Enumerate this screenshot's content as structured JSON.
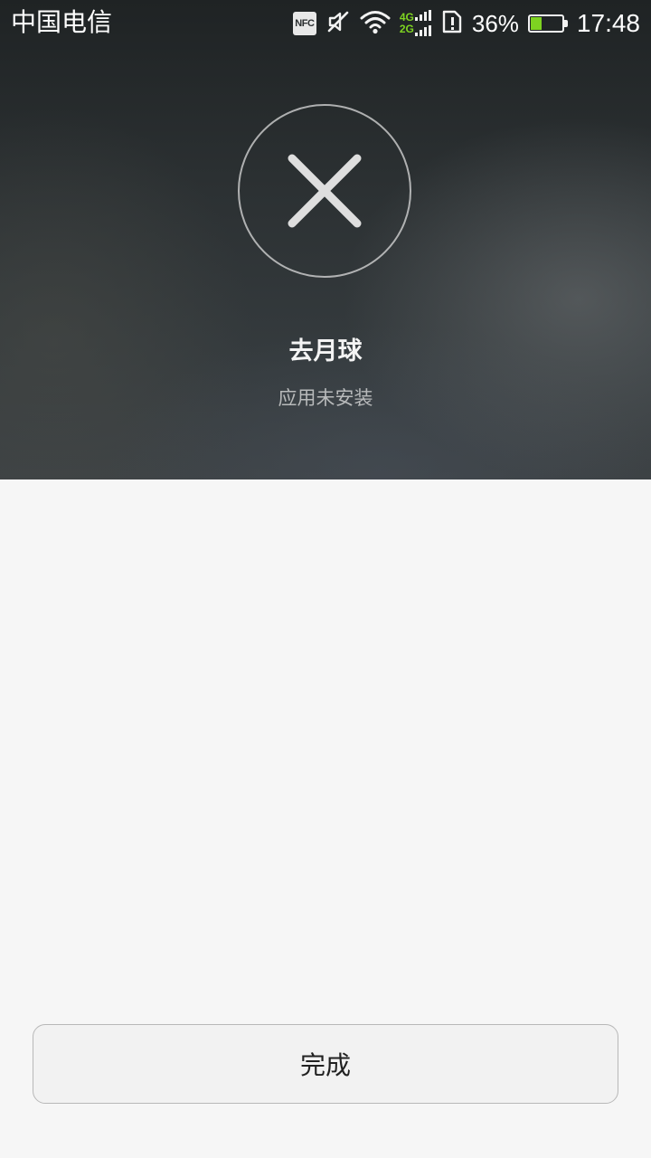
{
  "status_bar": {
    "carrier": "中国电信",
    "nfc_label": "NFC",
    "network_top": "4G",
    "network_bottom": "2G",
    "battery_percent": "36%",
    "battery_level": 0.36,
    "time": "17:48",
    "icons": [
      "nfc-icon",
      "mute-icon",
      "wifi-icon",
      "signal-icon",
      "sim-alert-icon",
      "battery-icon"
    ],
    "accent_color": "#7ed321"
  },
  "result": {
    "icon": "close-icon",
    "app_name": "去月球",
    "status": "应用未安装"
  },
  "footer": {
    "done_label": "完成"
  }
}
